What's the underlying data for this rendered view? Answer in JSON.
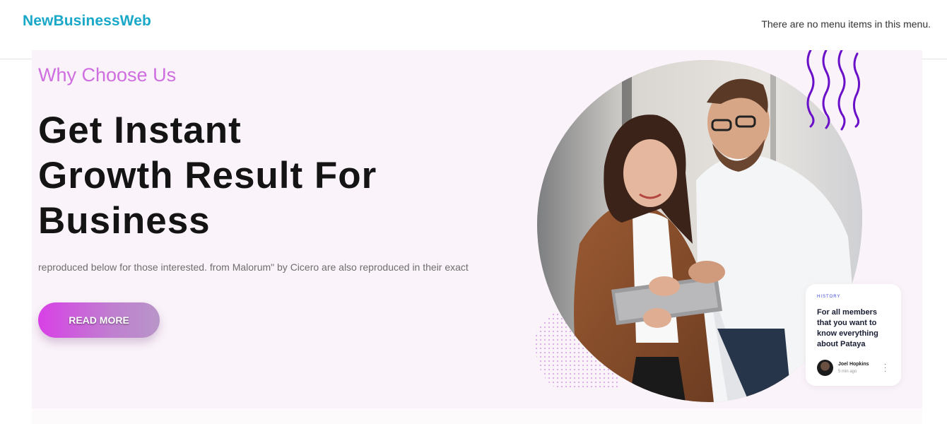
{
  "header": {
    "brand": "NewBusinessWeb",
    "menu_note": "There are no menu items in this menu."
  },
  "hero": {
    "eyebrow": "Why Choose Us",
    "headline_lines": [
      "Get Instant",
      "Growth Result For",
      "Business"
    ],
    "description": "reproduced below for those interested.  from  Malorum\" by Cicero are also reproduced in their exact",
    "cta_label": "READ MORE"
  },
  "card": {
    "tag": "HISTORY",
    "text": "For all members that you want to know everything about Pataya",
    "author": "Joel Hopkins",
    "time": "5 min ago",
    "more_icon": "more-vertical-icon"
  },
  "colors": {
    "brand": "#19a8c8",
    "eyebrow": "#cf6ee0",
    "hero_bg": "#faf3f9",
    "wave": "#6a10c9",
    "cta_start": "#d840e6",
    "cta_end": "#b896c8"
  }
}
